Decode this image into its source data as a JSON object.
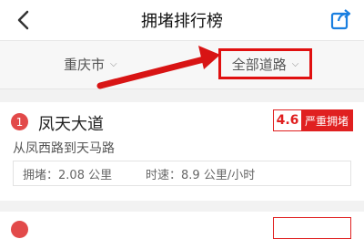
{
  "header": {
    "title": "拥堵排行榜",
    "back_icon": "back-icon",
    "share_icon": "share-icon"
  },
  "filters": {
    "city": "重庆市",
    "road_type": "全部道路",
    "highlight_color": "#e01010"
  },
  "ranking": [
    {
      "rank": "1",
      "road": "凤天大道",
      "index": "4.6",
      "level": "严重拥堵",
      "direction": "从凤西路到天马路",
      "congestion_label": "拥堵：",
      "congestion_value": "2.08 公里",
      "speed_label": "时速：",
      "speed_value": "8.9 公里/小时"
    }
  ],
  "colors": {
    "accent_red": "#e02020",
    "badge_red": "#e24a4a",
    "share_blue": "#1a7fe0"
  }
}
